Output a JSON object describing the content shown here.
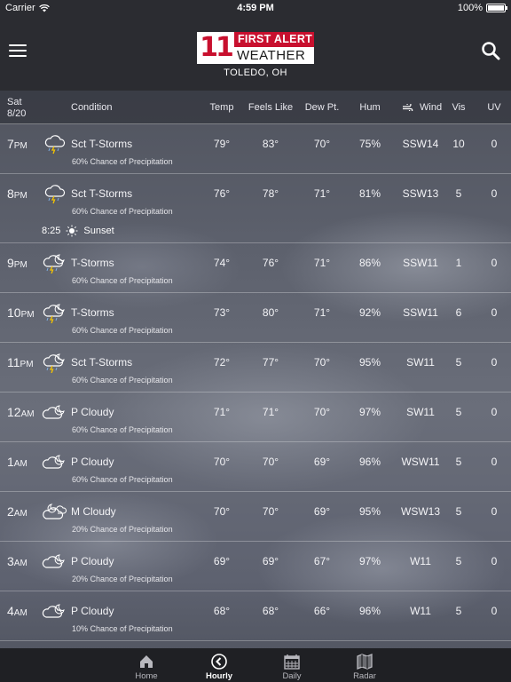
{
  "status_bar": {
    "carrier": "Carrier",
    "time": "4:59 PM",
    "battery": "100%",
    "battery_level": 1.0
  },
  "header": {
    "logo_number": "11",
    "logo_top": "FIRST ALERT",
    "logo_bottom": "WEATHER",
    "location": "TOLEDO, OH"
  },
  "columns": {
    "day": "Sat",
    "date": "8/20",
    "condition": "Condition",
    "temp": "Temp",
    "feels_like": "Feels Like",
    "dew_pt": "Dew Pt.",
    "hum": "Hum",
    "wind": "Wind",
    "vis": "Vis",
    "uv": "UV"
  },
  "rows": [
    {
      "hour": "7",
      "ampm": "PM",
      "icon": "thunderstorm-icon",
      "condition": "Sct T-Storms",
      "chance": "60% Chance of Precipitation",
      "temp": "79°",
      "feels": "83°",
      "dew": "70°",
      "hum": "75%",
      "wind": "SSW14",
      "vis": "10",
      "uv": "0"
    },
    {
      "hour": "8",
      "ampm": "PM",
      "icon": "thunderstorm-icon",
      "condition": "Sct T-Storms",
      "chance": "60% Chance of Precipitation",
      "temp": "76°",
      "feels": "78°",
      "dew": "71°",
      "hum": "81%",
      "wind": "SSW13",
      "vis": "5",
      "uv": "0",
      "sunset_time": "8:25",
      "sunset_label": "Sunset"
    },
    {
      "hour": "9",
      "ampm": "PM",
      "icon": "night-thunderstorm-icon",
      "condition": "T-Storms",
      "chance": "60% Chance of Precipitation",
      "temp": "74°",
      "feels": "76°",
      "dew": "71°",
      "hum": "86%",
      "wind": "SSW11",
      "vis": "1",
      "uv": "0"
    },
    {
      "hour": "10",
      "ampm": "PM",
      "icon": "night-thunderstorm-icon",
      "condition": "T-Storms",
      "chance": "60% Chance of Precipitation",
      "temp": "73°",
      "feels": "80°",
      "dew": "71°",
      "hum": "92%",
      "wind": "SSW11",
      "vis": "6",
      "uv": "0"
    },
    {
      "hour": "11",
      "ampm": "PM",
      "icon": "night-thunderstorm-icon",
      "condition": "Sct T-Storms",
      "chance": "60% Chance of Precipitation",
      "temp": "72°",
      "feels": "77°",
      "dew": "70°",
      "hum": "95%",
      "wind": "SW11",
      "vis": "5",
      "uv": "0"
    },
    {
      "hour": "12",
      "ampm": "AM",
      "icon": "night-cloudy-icon",
      "condition": "P Cloudy",
      "chance": "60% Chance of Precipitation",
      "temp": "71°",
      "feels": "71°",
      "dew": "70°",
      "hum": "97%",
      "wind": "SW11",
      "vis": "5",
      "uv": "0"
    },
    {
      "hour": "1",
      "ampm": "AM",
      "icon": "night-cloudy-icon",
      "condition": "P Cloudy",
      "chance": "60% Chance of Precipitation",
      "temp": "70°",
      "feels": "70°",
      "dew": "69°",
      "hum": "96%",
      "wind": "WSW11",
      "vis": "5",
      "uv": "0"
    },
    {
      "hour": "2",
      "ampm": "AM",
      "icon": "night-mostly-cloudy-icon",
      "condition": "M Cloudy",
      "chance": "20% Chance of Precipitation",
      "temp": "70°",
      "feels": "70°",
      "dew": "69°",
      "hum": "95%",
      "wind": "WSW13",
      "vis": "5",
      "uv": "0"
    },
    {
      "hour": "3",
      "ampm": "AM",
      "icon": "night-cloudy-icon",
      "condition": "P Cloudy",
      "chance": "20% Chance of Precipitation",
      "temp": "69°",
      "feels": "69°",
      "dew": "67°",
      "hum": "97%",
      "wind": "W11",
      "vis": "5",
      "uv": "0"
    },
    {
      "hour": "4",
      "ampm": "AM",
      "icon": "night-cloudy-icon",
      "condition": "P Cloudy",
      "chance": "10% Chance of Precipitation",
      "temp": "68°",
      "feels": "68°",
      "dew": "66°",
      "hum": "96%",
      "wind": "W11",
      "vis": "5",
      "uv": "0"
    }
  ],
  "tabs": [
    {
      "label": "Home",
      "icon": "home-icon",
      "active": false
    },
    {
      "label": "Hourly",
      "icon": "clock-icon",
      "active": true
    },
    {
      "label": "Daily",
      "icon": "calendar-icon",
      "active": false
    },
    {
      "label": "Radar",
      "icon": "map-icon",
      "active": false
    }
  ],
  "colors": {
    "brand_red": "#c8102e",
    "header_bg": "#2b2c31",
    "tabbar_bg": "#1f2024"
  }
}
